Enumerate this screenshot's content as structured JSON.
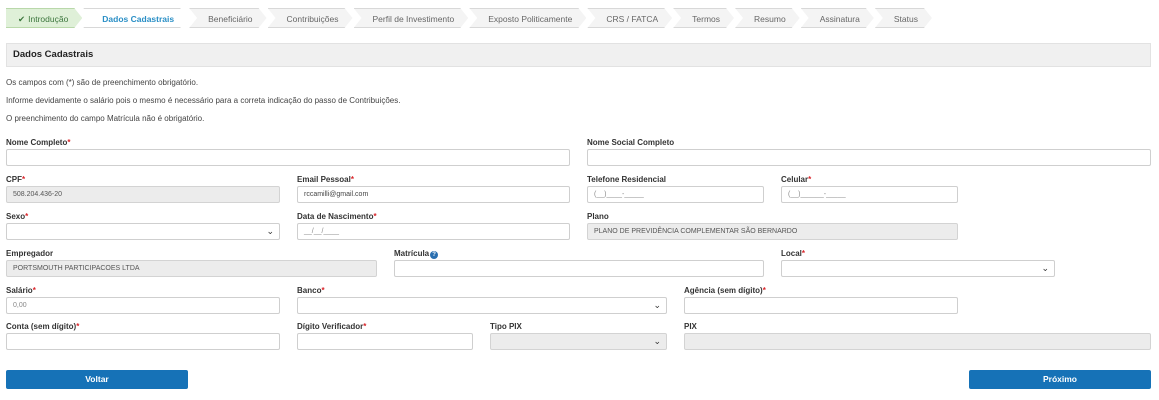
{
  "steps": [
    {
      "label": "Introdução",
      "state": "done"
    },
    {
      "label": "Dados Cadastrais",
      "state": "active"
    },
    {
      "label": "Beneficiário",
      "state": "todo"
    },
    {
      "label": "Contribuições",
      "state": "todo"
    },
    {
      "label": "Perfil de Investimento",
      "state": "todo"
    },
    {
      "label": "Exposto Politicamente",
      "state": "todo"
    },
    {
      "label": "CRS / FATCA",
      "state": "todo"
    },
    {
      "label": "Termos",
      "state": "todo"
    },
    {
      "label": "Resumo",
      "state": "todo"
    },
    {
      "label": "Assinatura",
      "state": "todo"
    },
    {
      "label": "Status",
      "state": "todo"
    }
  ],
  "section": {
    "title": "Dados Cadastrais"
  },
  "notes": [
    "Os campos com (*) são de preenchimento obrigatório.",
    "Informe devidamente o salário pois o mesmo é necessário para a correta indicação do passo de Contribuições.",
    "O preenchimento do campo Matrícula não é obrigatório."
  ],
  "form": {
    "nome_completo": {
      "label": "Nome Completo",
      "required": "*",
      "value": ""
    },
    "nome_social": {
      "label": "Nome Social Completo",
      "value": ""
    },
    "cpf": {
      "label": "CPF",
      "required": "*",
      "value": "508.204.436-20"
    },
    "email": {
      "label": "Email Pessoal",
      "required": "*",
      "value": "rccamilli@gmail.com"
    },
    "telefone": {
      "label": "Telefone Residencial",
      "placeholder": "(__)____-_____"
    },
    "celular": {
      "label": "Celular",
      "required": "*",
      "placeholder": "(__)______-_____"
    },
    "sexo": {
      "label": "Sexo",
      "required": "*",
      "value": ""
    },
    "nascimento": {
      "label": "Data de Nascimento",
      "required": "*",
      "placeholder": "__/__/____"
    },
    "plano": {
      "label": "Plano",
      "value": "PLANO DE PREVIDÊNCIA COMPLEMENTAR SÃO BERNARDO"
    },
    "empregador": {
      "label": "Empregador",
      "value": "PORTSMOUTH PARTICIPACOES LTDA"
    },
    "matricula": {
      "label": "Matrícula",
      "help": "?",
      "value": ""
    },
    "local": {
      "label": "Local",
      "required": "*",
      "value": ""
    },
    "salario": {
      "label": "Salário",
      "required": "*",
      "placeholder": "0,00"
    },
    "banco": {
      "label": "Banco",
      "required": "*",
      "value": ""
    },
    "agencia": {
      "label": "Agência (sem dígito)",
      "required": "*",
      "value": ""
    },
    "conta": {
      "label": "Conta (sem dígito)",
      "required": "*",
      "value": ""
    },
    "digito": {
      "label": "Dígito Verificador",
      "required": "*",
      "value": ""
    },
    "tipo_pix": {
      "label": "Tipo PIX",
      "value": ""
    },
    "pix": {
      "label": "PIX",
      "value": ""
    }
  },
  "buttons": {
    "back": "Voltar",
    "next": "Próximo"
  },
  "colors": {
    "primary": "#1672b7",
    "active_step": "#2a8fc6",
    "done_step": "#dff0d8",
    "required": "#d9262b"
  }
}
